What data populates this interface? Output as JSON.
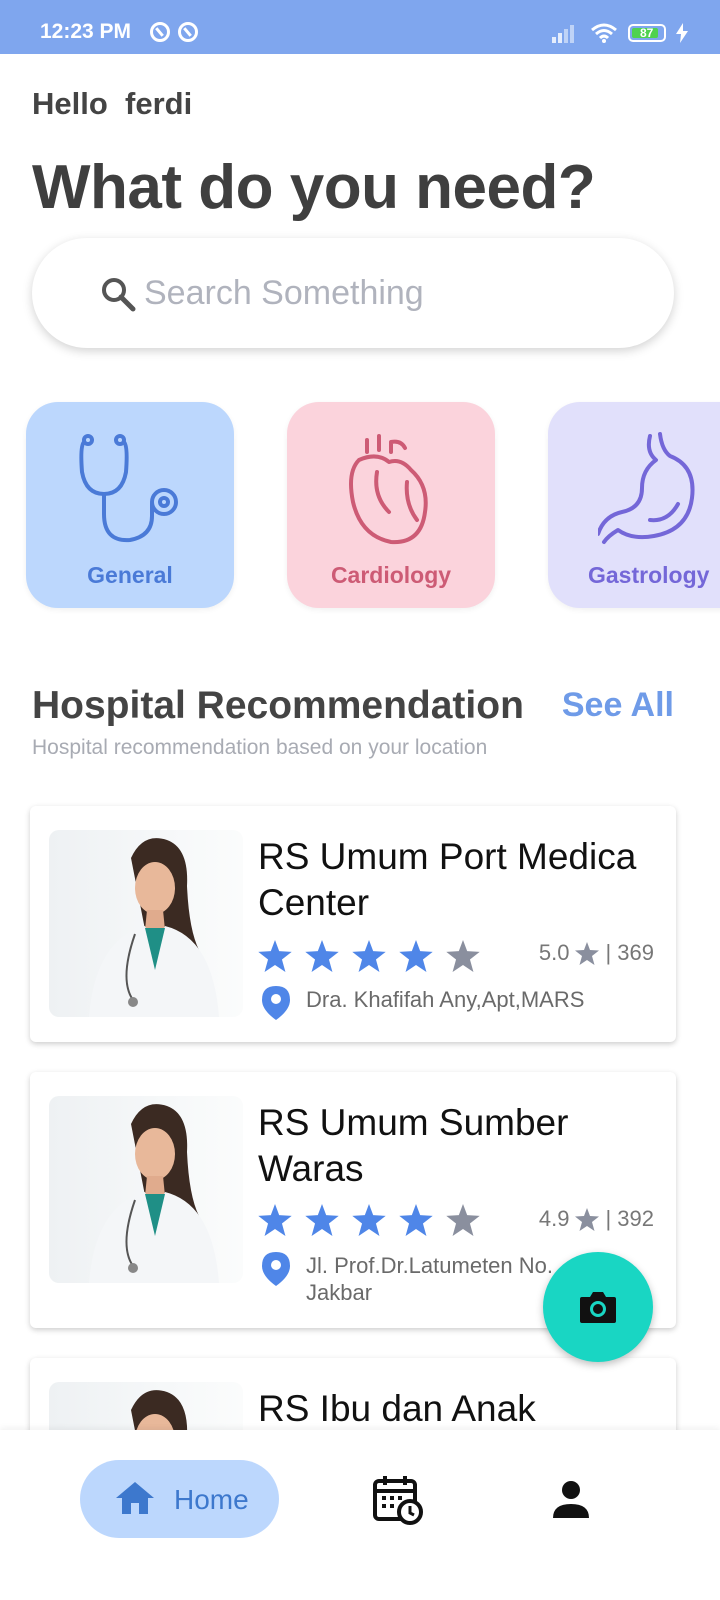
{
  "status_bar": {
    "time": "12:23 PM",
    "battery": "87"
  },
  "greeting": "Hello  ferdi",
  "headline": "What do you need?",
  "search": {
    "placeholder": "Search Something"
  },
  "categories": [
    {
      "label": "General",
      "icon": "stethoscope-icon"
    },
    {
      "label": "Cardiology",
      "icon": "heart-organ-icon"
    },
    {
      "label": "Gastrology",
      "icon": "stomach-icon"
    }
  ],
  "section": {
    "title": "Hospital Recommendation",
    "subtitle": "Hospital recommendation based on your location",
    "see_all": "See All"
  },
  "hospitals": [
    {
      "name": "RS Umum Port Medica Center",
      "rating": "5.0",
      "reviews": "| 369",
      "stars": 4,
      "address": "Dra. Khafifah Any,Apt,MARS"
    },
    {
      "name": "RS Umum Sumber Waras",
      "rating": "4.9",
      "reviews": "| 392",
      "stars": 4,
      "address": "Jl. Prof.Dr.Latumeten No. Jakbar"
    },
    {
      "name": "RS Ibu dan Anak"
    }
  ],
  "bottom_nav": {
    "home": "Home"
  },
  "colors": {
    "accent": "#7fa6ee",
    "fab": "#19d6c3",
    "star": "#4f86e8"
  }
}
